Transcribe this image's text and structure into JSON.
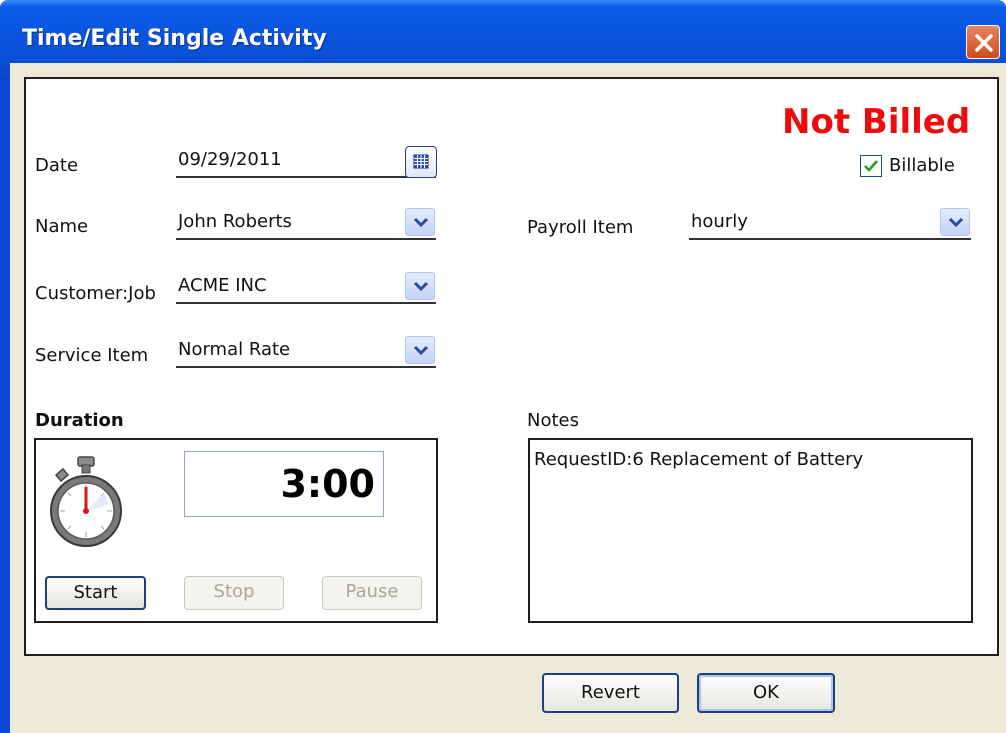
{
  "window": {
    "title": "Time/Edit Single Activity"
  },
  "status": {
    "text": "Not Billed",
    "color": "#ee0b0b"
  },
  "billable": {
    "label": "Billable",
    "checked": true
  },
  "fields": {
    "date": {
      "label": "Date",
      "value": "09/29/2011"
    },
    "name": {
      "label": "Name",
      "value": "John Roberts"
    },
    "customer_job": {
      "label": "Customer:Job",
      "value": "ACME INC"
    },
    "service_item": {
      "label": "Service Item",
      "value": "Normal Rate"
    },
    "payroll_item": {
      "label": "Payroll Item",
      "value": "hourly"
    }
  },
  "duration": {
    "label": "Duration",
    "time": "3:00",
    "buttons": {
      "start": "Start",
      "stop": "Stop",
      "pause": "Pause"
    }
  },
  "notes": {
    "label": "Notes",
    "text": "RequestID:6 Replacement of Battery"
  },
  "footer": {
    "revert_label": "Revert",
    "ok_label": "OK"
  },
  "icons": {
    "close": "close-icon",
    "calendar": "calendar-icon",
    "dropdown": "chevron-down-icon",
    "stopwatch": "stopwatch-icon",
    "checkmark": "checkmark-icon"
  }
}
